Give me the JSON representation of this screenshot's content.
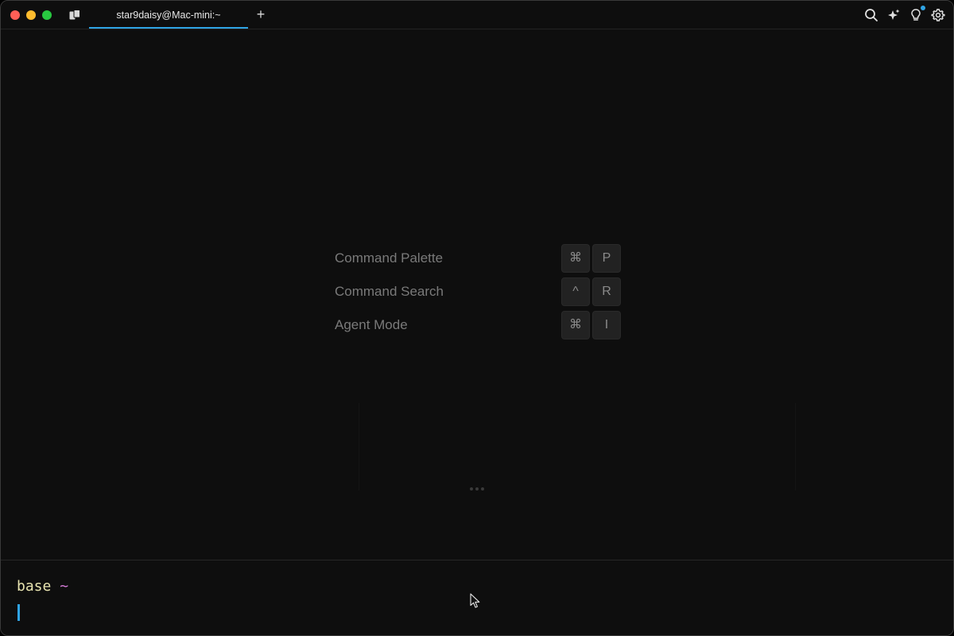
{
  "window": {
    "tab_title": "star9daisy@Mac-mini:~",
    "new_tab_label": "+"
  },
  "toolbar": {
    "icons": [
      "search-icon",
      "sparkle-icon",
      "lightbulb-icon",
      "gear-icon"
    ]
  },
  "shortcuts": [
    {
      "label": "Command Palette",
      "keys": [
        "⌘",
        "P"
      ]
    },
    {
      "label": "Command Search",
      "keys": [
        "^",
        "R"
      ]
    },
    {
      "label": "Agent Mode",
      "keys": [
        "⌘",
        "I"
      ]
    }
  ],
  "prompt": {
    "env": "base",
    "dir": "~"
  },
  "colors": {
    "accent": "#2fa4e4",
    "prompt_env": "#e8e4b0",
    "prompt_dir": "#d57bd8",
    "background": "#0e0e0e"
  }
}
